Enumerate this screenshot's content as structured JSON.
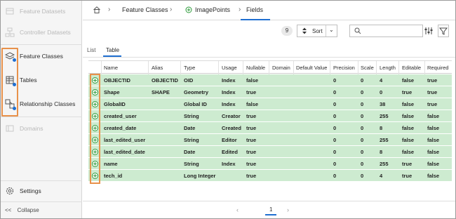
{
  "sidebar": {
    "items": [
      {
        "label": "Feature Datasets",
        "icon": "feature-datasets-icon",
        "disabled": true
      },
      {
        "label": "Controller Datasets",
        "icon": "controller-datasets-icon",
        "disabled": true
      },
      {
        "label": "Feature Classes",
        "icon": "layers-icon",
        "disabled": false
      },
      {
        "label": "Tables",
        "icon": "table-icon",
        "disabled": false
      },
      {
        "label": "Relationship Classes",
        "icon": "relationship-icon",
        "disabled": false
      },
      {
        "label": "Domains",
        "icon": "domains-icon",
        "disabled": true
      }
    ],
    "settings_label": "Settings",
    "collapse_label": "Collapse"
  },
  "breadcrumb": {
    "items": [
      "Feature Classes",
      "ImagePoints",
      "Fields"
    ]
  },
  "toolbar": {
    "count": "9",
    "sort_label": "Sort",
    "search_placeholder": ""
  },
  "view_tabs": {
    "list_label": "List",
    "table_label": "Table"
  },
  "table": {
    "headers": [
      "Name",
      "Alias",
      "Type",
      "Usage",
      "Nullable",
      "Domain",
      "Default Value",
      "Precision",
      "Scale",
      "Length",
      "Editable",
      "Required"
    ],
    "rows": [
      [
        "OBJECTID",
        "OBJECTID",
        "OID",
        "Index",
        "false",
        "",
        "",
        "0",
        "0",
        "4",
        "false",
        "true"
      ],
      [
        "Shape",
        "SHAPE",
        "Geometry",
        "Index",
        "true",
        "",
        "",
        "0",
        "0",
        "0",
        "true",
        "true"
      ],
      [
        "GlobalID",
        "",
        "Global ID",
        "Index",
        "false",
        "",
        "",
        "0",
        "0",
        "38",
        "false",
        "true"
      ],
      [
        "created_user",
        "",
        "String",
        "Creator",
        "true",
        "",
        "",
        "0",
        "0",
        "255",
        "false",
        "false"
      ],
      [
        "created_date",
        "",
        "Date",
        "Created",
        "true",
        "",
        "",
        "0",
        "0",
        "8",
        "false",
        "false"
      ],
      [
        "last_edited_user",
        "",
        "String",
        "Editor",
        "true",
        "",
        "",
        "0",
        "0",
        "255",
        "false",
        "false"
      ],
      [
        "last_edited_date",
        "",
        "Date",
        "Edited",
        "true",
        "",
        "",
        "0",
        "0",
        "8",
        "false",
        "false"
      ],
      [
        "name",
        "",
        "String",
        "Index",
        "true",
        "",
        "",
        "0",
        "0",
        "255",
        "true",
        "false"
      ],
      [
        "tech_id",
        "",
        "Long Integer",
        "",
        "true",
        "",
        "",
        "0",
        "0",
        "4",
        "true",
        "false"
      ]
    ]
  },
  "pagination": {
    "current_page": "1"
  },
  "colors": {
    "row_highlight": "#cdebd0",
    "accent": "#1f6fd1",
    "annotation_orange": "#e8914a"
  }
}
